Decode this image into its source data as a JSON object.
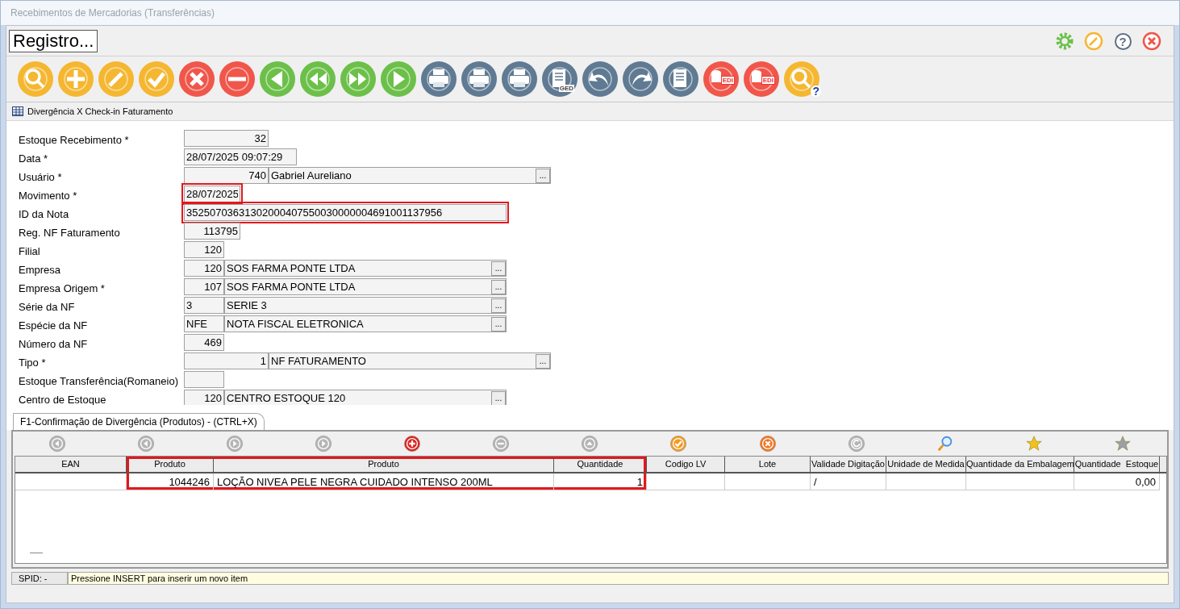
{
  "window": {
    "title": "Recebimentos de Mercadorias (Transferências)"
  },
  "header": {
    "title": "Registro...",
    "buttons": [
      {
        "kind": "settings"
      },
      {
        "kind": "wand"
      },
      {
        "kind": "help",
        "label": "?"
      },
      {
        "kind": "close"
      }
    ]
  },
  "toolbar": [
    {
      "kind": "search",
      "color": "#f5b731"
    },
    {
      "kind": "add",
      "color": "#f5b731"
    },
    {
      "kind": "edit",
      "color": "#f5b731"
    },
    {
      "kind": "confirm",
      "color": "#f5b731"
    },
    {
      "kind": "cancel",
      "color": "#f0564a"
    },
    {
      "kind": "remove",
      "color": "#f0564a"
    },
    {
      "kind": "left",
      "color": "#6cc04a"
    },
    {
      "kind": "double-left",
      "color": "#6cc04a"
    },
    {
      "kind": "double-right",
      "color": "#6cc04a"
    },
    {
      "kind": "right",
      "color": "#6cc04a"
    },
    {
      "kind": "print-preview",
      "color": "#5f7a92"
    },
    {
      "kind": "print",
      "color": "#5f7a92"
    },
    {
      "kind": "print-mail",
      "color": "#5f7a92"
    },
    {
      "kind": "document",
      "color": "#5f7a92",
      "label": "GED"
    },
    {
      "kind": "undo",
      "color": "#5f7a92"
    },
    {
      "kind": "redo",
      "color": "#5f7a92"
    },
    {
      "kind": "list",
      "color": "#5f7a92"
    },
    {
      "kind": "database",
      "color": "#f0564a",
      "label": "EDI"
    },
    {
      "kind": "database",
      "color": "#f0564a",
      "label": "EDI"
    },
    {
      "kind": "help-search",
      "color": "#f5b731",
      "label": "?"
    }
  ],
  "section": {
    "title": "Divergência X Check-in Faturamento"
  },
  "fields": [
    {
      "label": "Estoque Recebimento *",
      "code": "32",
      "numeric": true,
      "highlighted": false
    },
    {
      "label": "Data *",
      "code": "28/07/2025 09:07:29",
      "numeric": false,
      "highlighted": false
    },
    {
      "label": "Usuário *",
      "code": "740",
      "numeric": true,
      "description": "Gabriel Aureliano",
      "button": "...",
      "highlighted": false
    },
    {
      "label": "Movimento *",
      "code": "28/07/2025",
      "numeric": false,
      "highlighted": true
    },
    {
      "label": "ID da Nota",
      "code": "35250703631302000407550030000004691001137956",
      "numeric": false,
      "highlighted": true
    },
    {
      "label": "Reg. NF Faturamento",
      "code": "113795",
      "numeric": true,
      "highlighted": false
    },
    {
      "label": "Filial",
      "code": "120",
      "numeric": true,
      "highlighted": false
    },
    {
      "label": "Empresa",
      "code": "120",
      "numeric": true,
      "description": "SOS FARMA PONTE LTDA",
      "button": "...",
      "highlighted": false
    },
    {
      "label": "Empresa Origem *",
      "code": "107",
      "numeric": true,
      "description": "SOS FARMA PONTE LTDA",
      "button": "...",
      "highlighted": false
    },
    {
      "label": "Série da NF",
      "code": "3",
      "numeric": false,
      "description": "SERIE 3",
      "button": "...",
      "highlighted": false
    },
    {
      "label": "Espécie da NF",
      "code": "NFE",
      "numeric": false,
      "description": "NOTA FISCAL ELETRONICA",
      "button": "...",
      "highlighted": false
    },
    {
      "label": "Número da NF",
      "code": "469",
      "numeric": true,
      "highlighted": false
    },
    {
      "label": "Tipo *",
      "code": "1",
      "numeric": true,
      "description": "NF FATURAMENTO",
      "button": "...",
      "highlighted": false
    },
    {
      "label": "Estoque Transferência(Romaneio)",
      "highlighted": false
    },
    {
      "label": "Centro de Estoque",
      "code": "120",
      "numeric": true,
      "description": "CENTRO ESTOQUE 120",
      "button": "...",
      "highlighted": false
    }
  ],
  "tabs": [
    {
      "label": "F1-Confirmação de Divergência (Produtos) - (CTRL+X)",
      "selected": true
    }
  ],
  "grid_toolbar": [
    {
      "kind": "first",
      "disabled": true
    },
    {
      "kind": "prev",
      "disabled": true
    },
    {
      "kind": "next",
      "disabled": true
    },
    {
      "kind": "last",
      "disabled": true
    },
    {
      "kind": "add",
      "disabled": false
    },
    {
      "kind": "remove",
      "disabled": true
    },
    {
      "kind": "up",
      "disabled": true
    },
    {
      "kind": "confirm",
      "disabled": false
    },
    {
      "kind": "cancel",
      "disabled": false
    },
    {
      "kind": "refresh",
      "disabled": true
    },
    {
      "kind": "search",
      "disabled": false
    },
    {
      "kind": "star",
      "disabled": false
    },
    {
      "kind": "star-tool",
      "disabled": false
    }
  ],
  "table": {
    "columns": [
      {
        "label": "EAN",
        "numeric": false,
        "highlighted": false
      },
      {
        "label": "Produto",
        "numeric": true,
        "highlighted": true
      },
      {
        "label": "Produto",
        "numeric": false,
        "highlighted": true
      },
      {
        "label": "Quantidade",
        "numeric": true,
        "highlighted": true
      },
      {
        "label": "Codigo LV",
        "numeric": false,
        "highlighted": false
      },
      {
        "label": "Lote",
        "numeric": false,
        "highlighted": false
      },
      {
        "label": "Validade Digitação",
        "numeric": false,
        "highlighted": false
      },
      {
        "label": "Unidade de Medida",
        "numeric": false,
        "highlighted": false
      },
      {
        "label": "Quantidade da Embalagem",
        "numeric": false,
        "highlighted": false
      },
      {
        "label": "Quantidade  Estoque",
        "numeric": true,
        "highlighted": false
      }
    ],
    "rows": [
      [
        "",
        "1044246",
        "LOÇÃO NIVEA PELE NEGRA CUIDADO INTENSO 200ML",
        "1",
        "",
        "",
        "/",
        "",
        "",
        "0,00"
      ]
    ]
  },
  "status_bar": {
    "spid": "SPID: -",
    "message": "Pressione INSERT para inserir um novo item"
  }
}
